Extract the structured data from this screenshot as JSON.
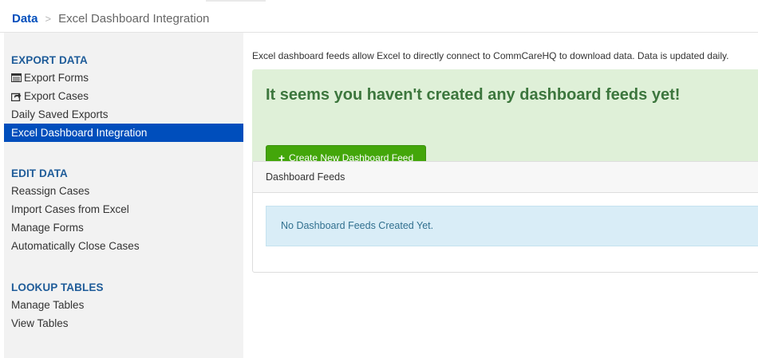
{
  "breadcrumb": {
    "root": "Data",
    "separator": ">",
    "current": "Excel Dashboard Integration"
  },
  "sidebar": {
    "sections": [
      {
        "header": "EXPORT DATA",
        "items": [
          {
            "label": "Export Forms",
            "icon": "table-icon"
          },
          {
            "label": "Export Cases",
            "icon": "share-icon"
          },
          {
            "label": "Daily Saved Exports"
          },
          {
            "label": "Excel Dashboard Integration",
            "active": true
          }
        ]
      },
      {
        "header": "EDIT DATA",
        "items": [
          {
            "label": "Reassign Cases"
          },
          {
            "label": "Import Cases from Excel"
          },
          {
            "label": "Manage Forms"
          },
          {
            "label": "Automatically Close Cases"
          }
        ]
      },
      {
        "header": "LOOKUP TABLES",
        "items": [
          {
            "label": "Manage Tables"
          },
          {
            "label": "View Tables"
          }
        ]
      }
    ]
  },
  "main": {
    "intro": "Excel dashboard feeds allow Excel to directly connect to CommCareHQ to download data. Data is updated daily.",
    "alert_title": "It seems you haven't created any dashboard feeds yet!",
    "create_button": "Create New Dashboard Feed",
    "panel_title": "Dashboard Feeds",
    "empty_message": "No Dashboard Feeds Created Yet."
  },
  "colors": {
    "brand": "#004ebc",
    "section_header": "#1f5c99",
    "alert_bg": "#dff0d8",
    "alert_text": "#3c763d",
    "button_green": "#43a60a",
    "info_bg": "#d9edf7",
    "info_text": "#31708f"
  }
}
